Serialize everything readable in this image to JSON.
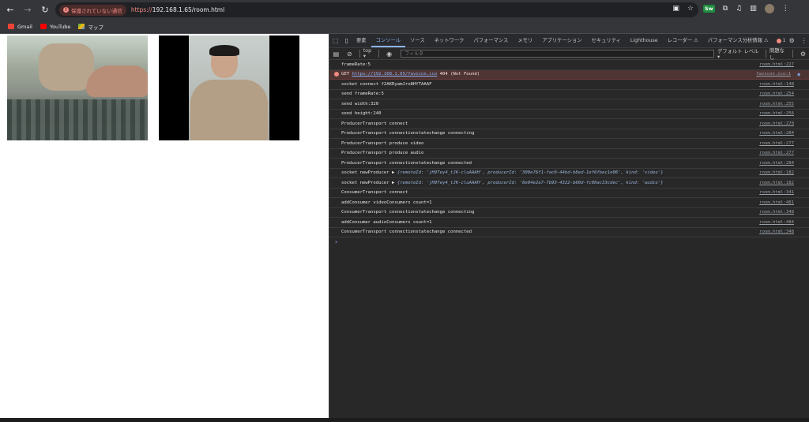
{
  "browser": {
    "security_warning": "保護されていない通信",
    "url_protocol": "https://",
    "url_rest": "192.168.1.65/room.html",
    "extension_badge": "Sw",
    "icons": [
      "back-icon",
      "forward-icon",
      "reload-icon",
      "camera-icon",
      "star-icon",
      "extensions-icon",
      "media-icon",
      "sidepanel-icon",
      "profile-icon",
      "menu-icon"
    ]
  },
  "bookmarks": [
    {
      "label": "Gmail",
      "icon": "gmail-icon",
      "color": "#ea4335"
    },
    {
      "label": "YouTube",
      "icon": "youtube-icon",
      "color": "#ff0000"
    },
    {
      "label": "マップ",
      "icon": "maps-icon",
      "color": "#34a853"
    }
  ],
  "devtools": {
    "tabs": [
      "要素",
      "コンソール",
      "ソース",
      "ネットワーク",
      "パフォーマンス",
      "メモリ",
      "アプリケーション",
      "セキュリティ",
      "Lighthouse",
      "レコーダー ⚠",
      "パフォーマンス分析情報 ⚠"
    ],
    "active_tab": "コンソール",
    "error_count": "1",
    "toolbar": {
      "context": "top",
      "filter_placeholder": "フィルタ",
      "level": "デフォルト レベル ▾",
      "issues": "問題なし"
    },
    "console_rows": [
      {
        "msg": "frameRate:5",
        "src": "room.html:227",
        "type": "log"
      },
      {
        "msg_prefix": "GET ",
        "msg_link": "https://192.168.1.65/favicon.ico",
        "msg_suffix": " 404 (Not Found)",
        "src": "favicon.ico:1",
        "type": "error"
      },
      {
        "msg": "socket connect f2AKRyamJro8HYTAAAF",
        "src": "room.html:148",
        "type": "log"
      },
      {
        "msg": "send frameRate:5",
        "src": "room.html:254",
        "type": "log"
      },
      {
        "msg": "send width:320",
        "src": "room.html:255",
        "type": "log"
      },
      {
        "msg": "send height:240",
        "src": "room.html:256",
        "type": "log"
      },
      {
        "msg": "ProducerTransport connect",
        "src": "room.html:270",
        "type": "log"
      },
      {
        "msg": "ProducerTransport connectionstatechange connecting",
        "src": "room.html:284",
        "type": "log"
      },
      {
        "msg": "ProducerTransport produce video",
        "src": "room.html:277",
        "type": "log"
      },
      {
        "msg": "ProducerTransport produce audio",
        "src": "room.html:277",
        "type": "log"
      },
      {
        "msg": "ProducerTransport connectionstatechange connected",
        "src": "room.html:284",
        "type": "log"
      },
      {
        "msg_prefix": "socket newProducer  ▶ ",
        "obj": "{remoteId: 'jH9Tey4_tJK-cluAAAH', producerId: '300e76f1-fac0-44bd-b8ed-1ef6fbec1e06', kind: 'video'}",
        "src": "room.html:182",
        "type": "obj"
      },
      {
        "msg_prefix": "socket newProducer  ▶ ",
        "obj": "{remoteId: 'jH9Tey4_tJK-cluAAAH', producerId: '8e04e2a7-7b93-4322-b60d-fc08ac33cdec', kind: 'audio'}",
        "src": "room.html:182",
        "type": "obj"
      },
      {
        "msg": "ConsumerTransport connect",
        "src": "room.html:341",
        "type": "log"
      },
      {
        "msg": "addConsumer videoConsumers count=1",
        "src": "room.html:481",
        "type": "log"
      },
      {
        "msg": "ConsumerTransport connectionstatechange connecting",
        "src": "room.html:348",
        "type": "log"
      },
      {
        "msg": "addConsumer audioConsumers count=1",
        "src": "room.html:484",
        "type": "log"
      },
      {
        "msg": "ConsumerTransport connectionstatechange connected",
        "src": "room.html:348",
        "type": "log"
      }
    ],
    "prompt": "›"
  }
}
